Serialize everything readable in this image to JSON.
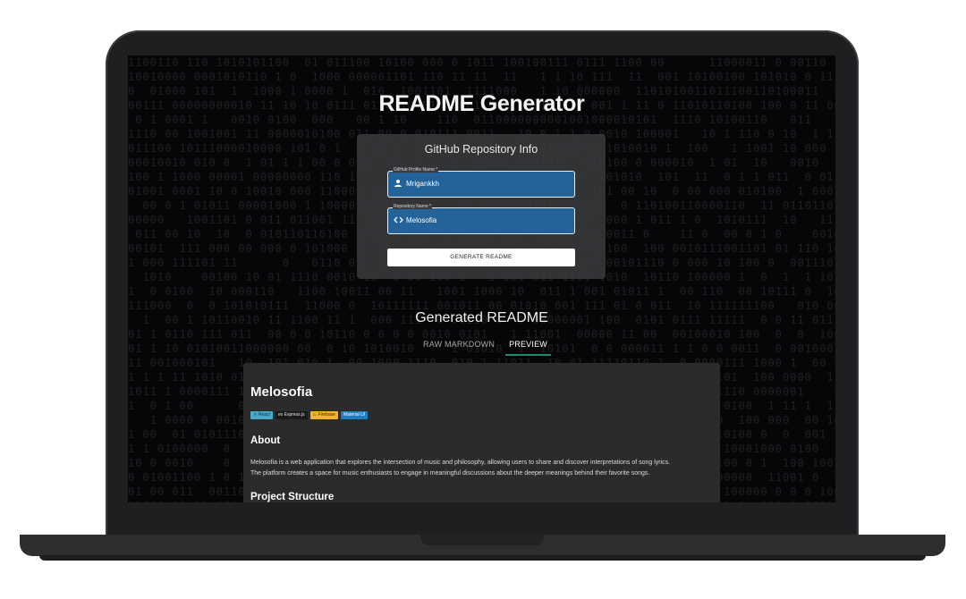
{
  "app": {
    "title": "README Generator"
  },
  "form": {
    "card_title": "GitHub Repository Info",
    "profile_label": "GitHub Profile Name *",
    "profile_value": "Mrigankkh",
    "repo_label": "Repository Name *",
    "repo_value": "Melosofia",
    "profile_icon": "person-icon",
    "repo_icon": "code-icon",
    "generate_label": "GENERATE README"
  },
  "output": {
    "title": "Generated README",
    "tabs": [
      "RAW MARKDOWN",
      "PREVIEW"
    ],
    "active_tab": "PREVIEW"
  },
  "preview": {
    "project_name": "Melosofia",
    "badges": [
      "React",
      "Express.js",
      "Firebase",
      "Material UI"
    ],
    "about_heading": "About",
    "about_line1": "Melosofia is a web application that explores the intersection of music and philosophy, allowing users to share and discover interpretations of song lyrics.",
    "about_line2": "The platform creates a space for music enthusiasts to engage in meaningful discussions about the deeper meanings behind their favorite songs.",
    "structure_heading": "Project Structure"
  },
  "colors": {
    "field_bg": "#24629a",
    "tab_underline": "#1f8a74",
    "background": "#050607"
  }
}
